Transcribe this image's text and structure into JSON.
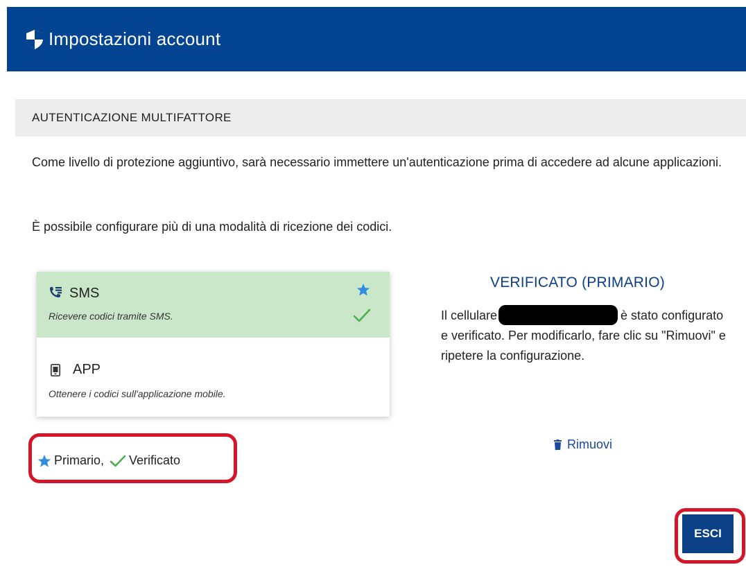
{
  "header": {
    "title": "Impostazioni account"
  },
  "section": {
    "title": "AUTENTICAZIONE MULTIFATTORE"
  },
  "intro": {
    "paragraph": "Come livello di protezione aggiuntivo, sarà necessario immettere un'autenticazione prima di accedere ad alcune applicazioni.",
    "note": "È possibile configurare più di una modalità di ricezione dei codici."
  },
  "methods": [
    {
      "label": "SMS",
      "description": "Ricevere codici tramite SMS.",
      "icon": "phone-sms-icon",
      "primary": true,
      "verified": true
    },
    {
      "label": "APP",
      "description": "Ottenere i codici sull'applicazione mobile.",
      "icon": "mobile-app-icon",
      "primary": false,
      "verified": false
    }
  ],
  "status": {
    "title": "VERIFICATO (PRIMARIO)",
    "text_before": "Il cellulare",
    "text_after": "è stato configurato e verificato. Per modificarlo, fare clic su \"Rimuovi\" e ripetere la configurazione."
  },
  "actions": {
    "remove_label": "Rimuovi",
    "exit_label": "ESCI"
  },
  "legend": {
    "primary_label": "Primario,",
    "verified_label": "Verificato"
  },
  "colors": {
    "header_bg": "#024492",
    "accent_blue": "#0b3f86",
    "selected_bg": "#cbe7c9",
    "check_green": "#4caf50",
    "star_blue": "#2f8ee0",
    "highlight_red": "#d4152a"
  }
}
